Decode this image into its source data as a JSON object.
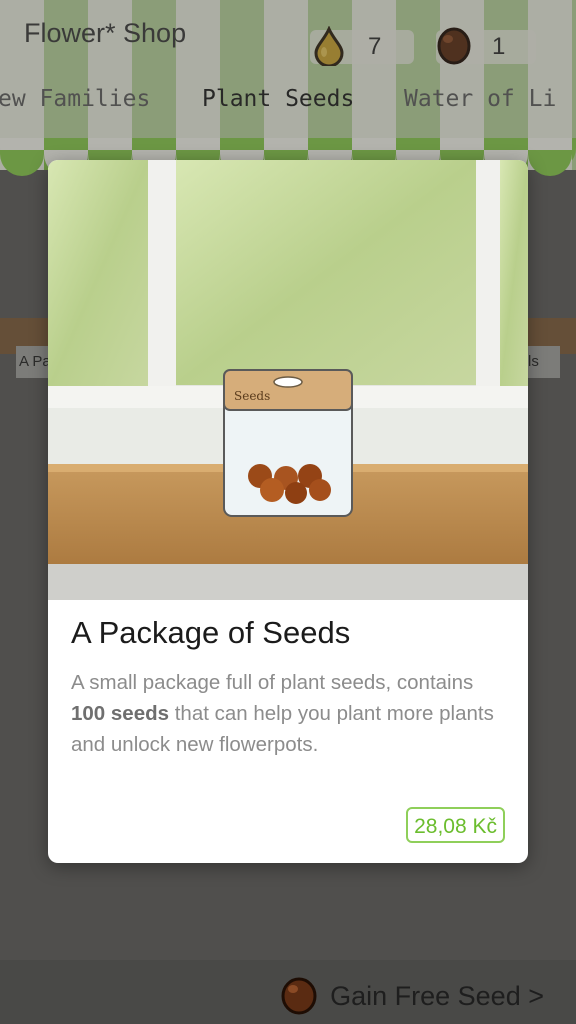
{
  "header": {
    "title": "Flower* Shop",
    "currencies": [
      {
        "icon": "water-drop-icon",
        "value": "7"
      },
      {
        "icon": "seed-icon",
        "value": "1"
      }
    ]
  },
  "tabs": [
    {
      "label": "ew Families"
    },
    {
      "label": "Plant Seeds",
      "active": true
    },
    {
      "label": "Water of Li"
    }
  ],
  "background_items": {
    "left_label": "A Pa",
    "right_label": "ls"
  },
  "modal": {
    "image_text": "Seeds",
    "title": "A Package of Seeds",
    "desc_before": "A small package full of plant seeds, contains ",
    "desc_bold": "100 seeds",
    "desc_after": " that can help you plant more plants and unlock new flowerpots.",
    "price": "28,08 Kč"
  },
  "footer": {
    "gain_label": "Gain Free Seed >"
  },
  "colors": {
    "accent_green": "#8fcf5a",
    "price_text": "#6bbd2e"
  }
}
